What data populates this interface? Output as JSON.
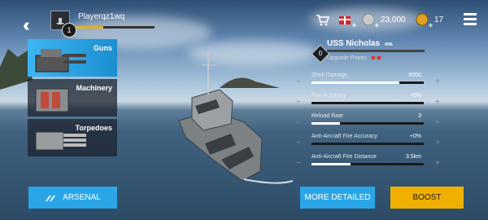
{
  "player": {
    "name": "Playerqz1wq",
    "level": "1"
  },
  "top_right": {
    "silver": "23,000",
    "gold": "17"
  },
  "categories": [
    {
      "label": "Guns",
      "active": true
    },
    {
      "label": "Machinery",
      "active": false
    },
    {
      "label": "Torpedoes",
      "active": false
    }
  ],
  "ship": {
    "name": "USS Nicholas",
    "rank": "0",
    "upgrade_label": "Upgrade Points:"
  },
  "stats": [
    {
      "label": "Shell Damage",
      "value": "6000",
      "fill": 0.78
    },
    {
      "label": "Fire Accuracy",
      "value": "+0%",
      "fill": 0.0
    },
    {
      "label": "Reload Rate",
      "value": "3",
      "fill": 0.25
    },
    {
      "label": "Anti-Aircraft Fire Accuracy",
      "value": "+0%",
      "fill": 0.0
    },
    {
      "label": "Anti-Aircraft Fire Distance",
      "value": "3.5km",
      "fill": 0.35
    }
  ],
  "buttons": {
    "arsenal": "ARSENAL",
    "more_detailed": "MORE DETAILED",
    "boost": "BOOST"
  },
  "colors": {
    "accent_blue": "#2aa6e8",
    "boost_yellow": "#f0b000",
    "xp_bar": "#e6b020"
  }
}
